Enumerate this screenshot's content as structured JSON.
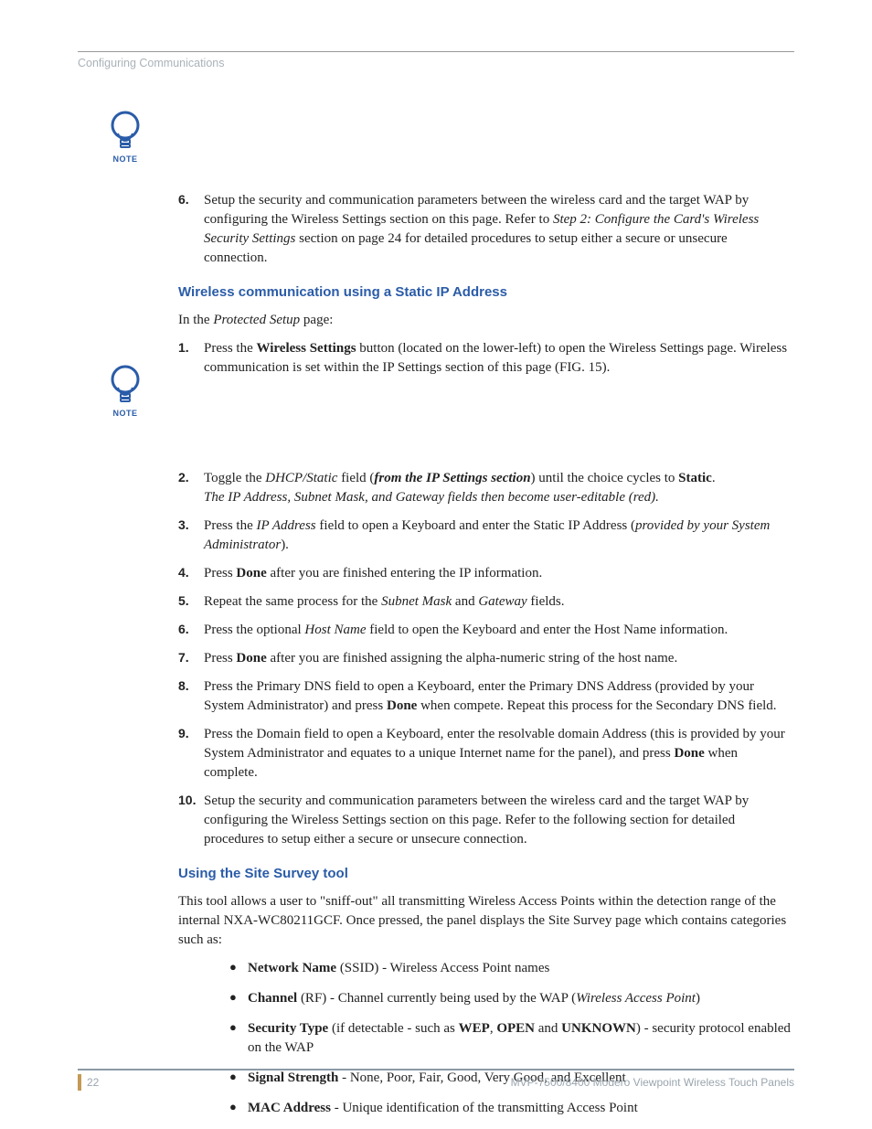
{
  "header": {
    "section": "Configuring Communications"
  },
  "note_label": "NOTE",
  "step6_top": {
    "pre": "Setup the security and communication parameters between the wireless card and the target WAP by configuring the Wireless Settings section on this page. Refer to ",
    "ref": "Step 2: Configure the Card's Wireless Security Settings",
    "post": " section on page 24 for detailed procedures to setup either a secure or unsecure connection."
  },
  "section1": {
    "title": "Wireless communication using a Static IP Address",
    "intro_pre": "In the ",
    "intro_em": "Protected Setup",
    "intro_post": " page:",
    "s1": {
      "a": "Press the ",
      "b": "Wireless Settings",
      "c": " button (located on the lower-left) to open the Wireless Settings page. Wireless communication is set within the IP Settings section of this page (FIG. 15)."
    },
    "s2": {
      "a": "Toggle the ",
      "em1": "DHCP/Static",
      "b": " field (",
      "bi": "from the IP Settings section",
      "c": ") until the choice cycles to ",
      "bold": "Static",
      "d": ". ",
      "line2": "The IP Address, Subnet Mask, and Gateway fields then become user-editable (red)."
    },
    "s3": {
      "a": "Press the ",
      "em": "IP Address",
      "b": " field to open a Keyboard and enter the Static IP Address (",
      "em2": "provided by your System Administrator",
      "c": ")."
    },
    "s4": {
      "a": "Press ",
      "b": "Done",
      "c": " after you are finished entering the IP information."
    },
    "s5": {
      "a": "Repeat the same process for the ",
      "em1": "Subnet Mask",
      "b": " and ",
      "em2": "Gateway",
      "c": " fields."
    },
    "s6": {
      "a": "Press the optional ",
      "em": "Host Name",
      "b": " field to open the Keyboard and enter the Host Name information."
    },
    "s7": {
      "a": "Press ",
      "b": "Done",
      "c": " after you are finished assigning the alpha-numeric string of the host name."
    },
    "s8": {
      "a": "Press the Primary DNS field to open a Keyboard, enter the Primary DNS Address (provided by your System Administrator) and press ",
      "b": "Done",
      "c": " when compete. Repeat this process for the Secondary DNS field."
    },
    "s9": {
      "a": "Press the Domain field to open a Keyboard, enter the resolvable domain Address (this is provided by your System Administrator and equates to a unique Internet name for the panel), and press ",
      "b": "Done",
      "c": " when complete."
    },
    "s10": "Setup the security and communication parameters between the wireless card and the target WAP by configuring the Wireless Settings section on this page. Refer to the following section for detailed procedures to setup either a secure or unsecure connection."
  },
  "section2": {
    "title": "Using the Site Survey tool",
    "intro": "This tool allows a user to \"sniff-out\" all transmitting Wireless Access Points within the detection range of the internal NXA-WC80211GCF. Once pressed, the panel displays the Site Survey page which contains categories such as:",
    "b1": {
      "bold": "Network Name",
      "rest": " (SSID) - Wireless Access Point names"
    },
    "b2": {
      "bold": "Channel",
      "a": " (RF) - Channel currently being used by the WAP (",
      "em": "Wireless Access Point",
      "b": ")"
    },
    "b3": {
      "bold": "Security Type",
      "a": " (if detectable - such as ",
      "w1": "WEP",
      "c1": ", ",
      "w2": "OPEN",
      "c2": " and ",
      "w3": "UNKNOWN",
      "b": ") - security protocol enabled on the WAP"
    },
    "b4": {
      "bold": "Signal Strength",
      "rest": " - None, Poor, Fair, Good, Very Good, and Excellent"
    },
    "b5": {
      "bold": "MAC Address",
      "rest": " - Unique identification of the transmitting Access Point"
    }
  },
  "footer": {
    "page": "22",
    "title": "MVP-7500/8400 Modero Viewpoint Wireless Touch Panels"
  }
}
